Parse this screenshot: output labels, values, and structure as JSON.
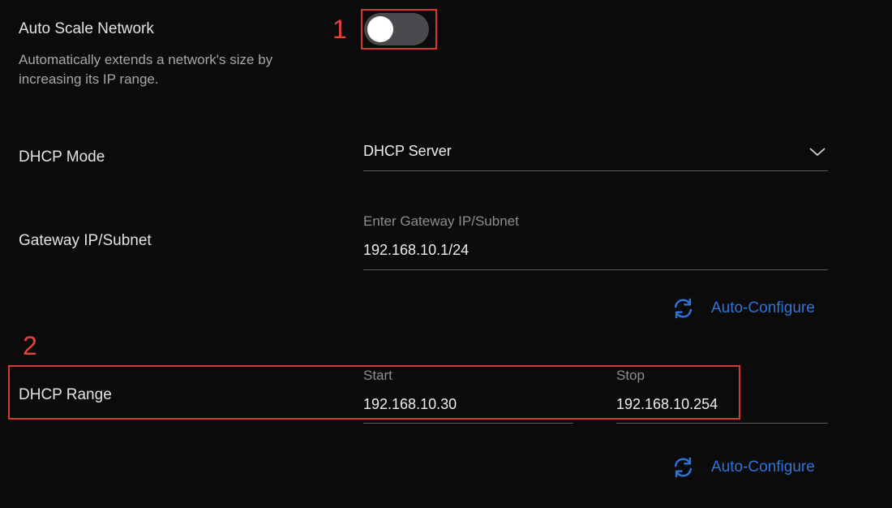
{
  "auto_scale": {
    "label": "Auto Scale Network",
    "description_line1": "Automatically extends a network's size by",
    "description_line2": "increasing its IP range.",
    "toggle_state": "off"
  },
  "dhcp_mode": {
    "label": "DHCP Mode",
    "value": "DHCP Server"
  },
  "gateway": {
    "label": "Gateway IP/Subnet",
    "placeholder": "Enter Gateway IP/Subnet",
    "value": "192.168.10.1/24",
    "auto_configure_label": "Auto-Configure"
  },
  "dhcp_range": {
    "label": "DHCP Range",
    "start_label": "Start",
    "start_value": "192.168.10.30",
    "stop_label": "Stop",
    "stop_value": "192.168.10.254",
    "auto_configure_label": "Auto-Configure"
  },
  "annotations": [
    "1",
    "2"
  ],
  "colors": {
    "background": "#0b0b0c",
    "accent": "#2f74d8",
    "annotation": "#d23b30",
    "toggle_track": "#4a4a4e"
  }
}
